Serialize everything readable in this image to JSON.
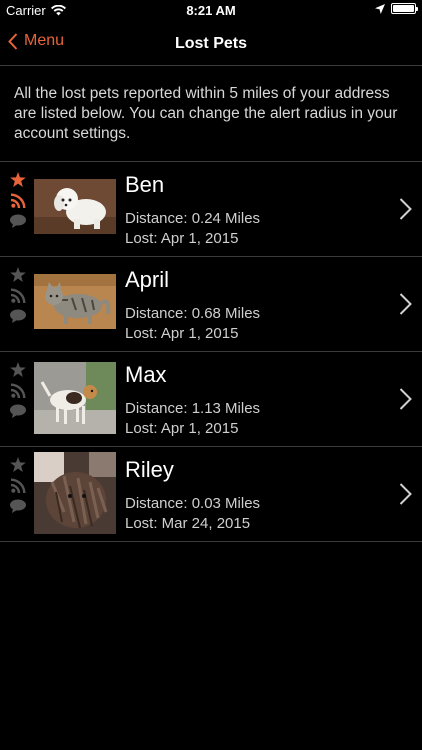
{
  "status_bar": {
    "carrier": "Carrier",
    "time": "8:21 AM"
  },
  "nav": {
    "back_label": "Menu",
    "title": "Lost Pets"
  },
  "intro_text": "All the lost pets reported within 5 miles of your address are listed below. You can change the alert radius in your account settings.",
  "colors": {
    "accent": "#e8643a",
    "inactive_icon": "#555555",
    "background": "#000000",
    "divider": "#3a3a3a"
  },
  "pets": [
    {
      "name": "Ben",
      "distance": "Distance: 0.24 Miles",
      "lost": "Lost: Apr 1, 2015",
      "favorited": true,
      "subscribed": true
    },
    {
      "name": "April",
      "distance": "Distance: 0.68 Miles",
      "lost": "Lost: Apr 1, 2015",
      "favorited": false,
      "subscribed": false
    },
    {
      "name": "Max",
      "distance": "Distance: 1.13 Miles",
      "lost": "Lost: Apr 1, 2015",
      "favorited": false,
      "subscribed": false
    },
    {
      "name": "Riley",
      "distance": "Distance: 0.03 Miles",
      "lost": "Lost: Mar 24, 2015",
      "favorited": false,
      "subscribed": false
    }
  ]
}
